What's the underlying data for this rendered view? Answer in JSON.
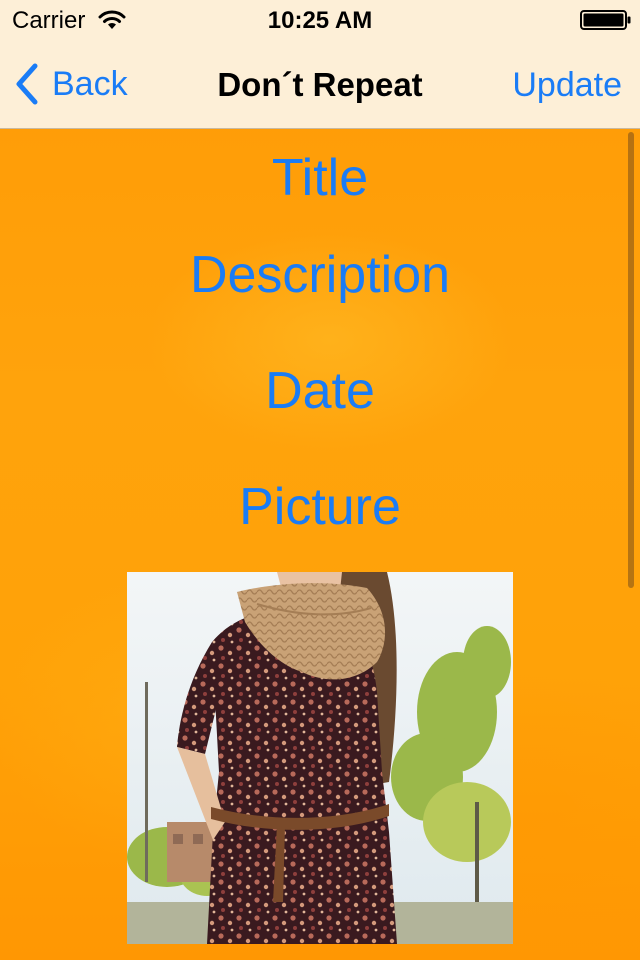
{
  "status_bar": {
    "carrier": "Carrier",
    "time": "10:25 AM",
    "wifi_icon": "wifi-icon",
    "battery_icon": "battery-icon",
    "battery_level": 1.0
  },
  "nav_bar": {
    "back_label": "Back",
    "back_icon": "chevron-left-icon",
    "title": "Don´t Repeat",
    "update_label": "Update"
  },
  "content": {
    "title_label": "Title",
    "description_label": "Description",
    "date_label": "Date",
    "picture_label": "Picture",
    "photo_subject": "woman in floral print dress with knit scarf"
  },
  "colors": {
    "accent": "#1a7cf6",
    "nav_background": "#fdefd7",
    "background": "#ffa208"
  }
}
